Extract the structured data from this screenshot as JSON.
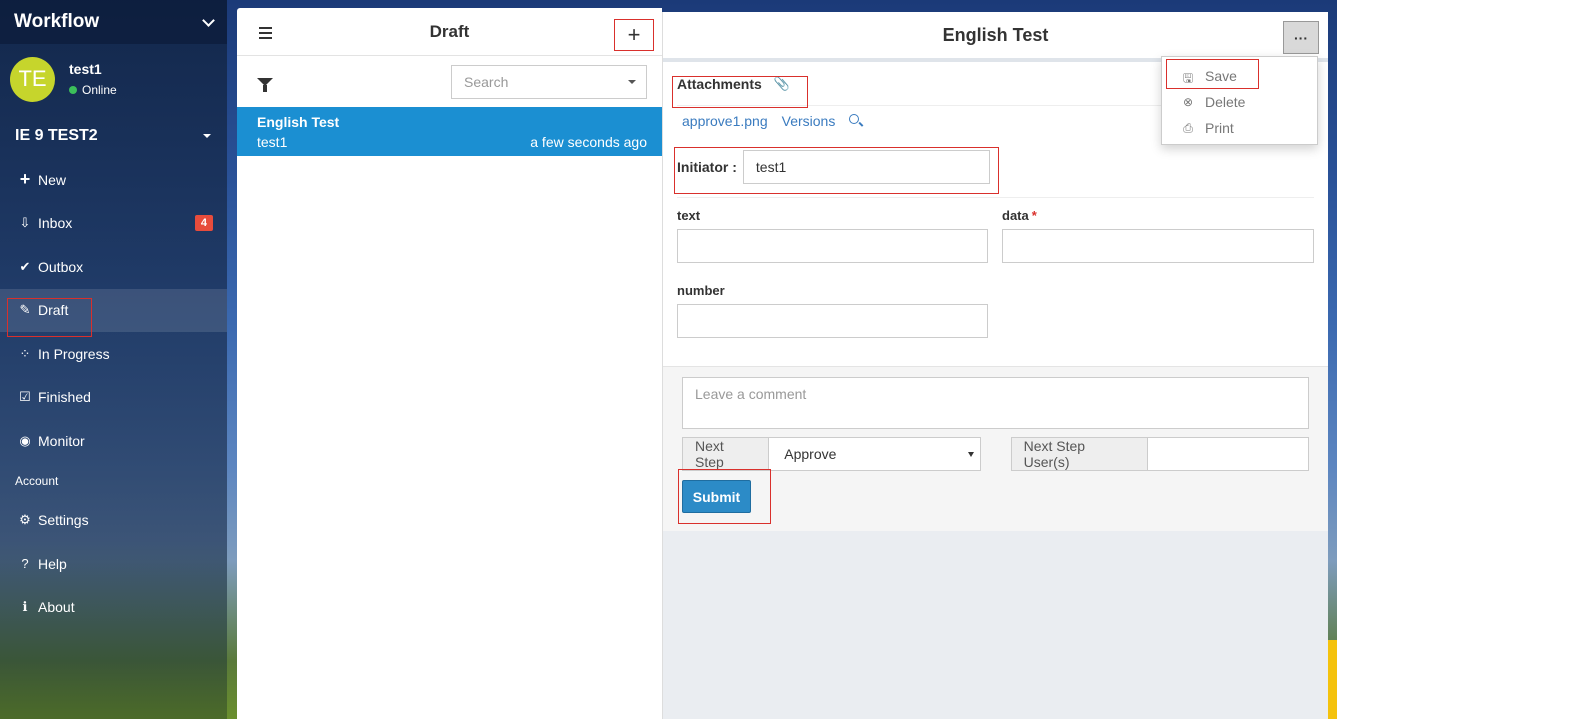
{
  "sidebar": {
    "brand": "Workflow",
    "user": {
      "initials": "TE",
      "name": "test1",
      "status": "Online"
    },
    "org": "IE 9 TEST2",
    "items": [
      {
        "label": "New",
        "icon": "plus-icon"
      },
      {
        "label": "Inbox",
        "icon": "inbox-icon",
        "badge": "4"
      },
      {
        "label": "Outbox",
        "icon": "double-check-icon"
      },
      {
        "label": "Draft",
        "icon": "edit-icon",
        "active": true
      },
      {
        "label": "In Progress",
        "icon": "spinner-icon"
      },
      {
        "label": "Finished",
        "icon": "checkbox-icon"
      },
      {
        "label": "Monitor",
        "icon": "eye-icon"
      }
    ],
    "section_account": "Account",
    "account_items": [
      {
        "label": "Settings",
        "icon": "gear-icon"
      },
      {
        "label": "Help",
        "icon": "help-icon"
      },
      {
        "label": "About",
        "icon": "info-icon"
      }
    ]
  },
  "list": {
    "title": "Draft",
    "search_placeholder": "Search",
    "items": [
      {
        "title": "English Test",
        "user": "test1",
        "time": "a few seconds ago"
      }
    ]
  },
  "detail": {
    "title": "English Test",
    "more_label": "···",
    "attachments_label": "Attachments",
    "files": [
      "approve1.png",
      "Versions"
    ],
    "initiator_label": "Initiator :",
    "initiator_value": "test1",
    "fields": [
      {
        "label": "text",
        "required": false
      },
      {
        "label": "data",
        "required": true
      },
      {
        "label": "number",
        "required": false
      }
    ],
    "comment_placeholder": "Leave a comment",
    "next_step_label": "Next Step",
    "next_step_value": "Approve",
    "next_step_users_label": "Next Step User(s)",
    "submit_label": "Submit"
  },
  "menu": {
    "items": [
      {
        "label": "Save",
        "icon": "save-icon"
      },
      {
        "label": "Delete",
        "icon": "delete-icon"
      },
      {
        "label": "Print",
        "icon": "print-icon"
      }
    ]
  },
  "colors": {
    "accent": "#1b8fd2",
    "submit": "#2c8bc7",
    "badge": "#e74c3c",
    "highlight_box": "#d9302c",
    "avatar": "#c6d52c"
  }
}
